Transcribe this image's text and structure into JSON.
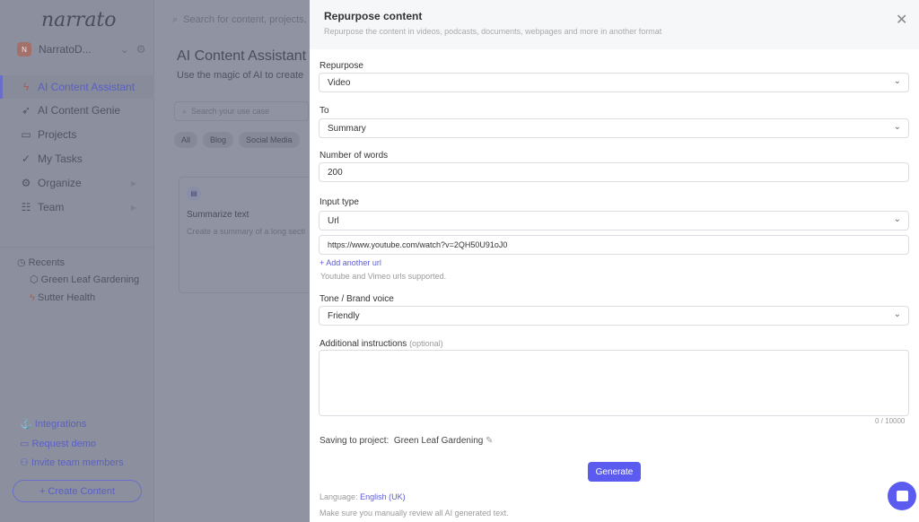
{
  "sidebar": {
    "logo": "narrato",
    "workspace": "NarratoD...",
    "workspace_initial": "N",
    "items": [
      {
        "label": "AI Content Assistant",
        "icon": "bolt-icon"
      },
      {
        "label": "AI Content Genie",
        "icon": "rocket-icon"
      },
      {
        "label": "Projects",
        "icon": "briefcase-icon"
      },
      {
        "label": "My Tasks",
        "icon": "check-icon"
      },
      {
        "label": "Organize",
        "icon": "gears-icon"
      },
      {
        "label": "Team",
        "icon": "team-icon"
      }
    ],
    "recents_label": "Recents",
    "recents": [
      "Green Leaf Gardening",
      "Sutter Health"
    ],
    "bottom": [
      "Integrations",
      "Request demo",
      "Invite team members"
    ],
    "create": "+ Create Content"
  },
  "main": {
    "search_placeholder": "Search for content, projects, a",
    "title": "AI Content Assistant",
    "subtitle": "Use the magic of AI to create",
    "usecase_placeholder": "Search your use case",
    "chips": [
      "All",
      "Blog",
      "Social Media"
    ],
    "card_title": "Summarize text",
    "card_desc": "Create a summary of a long secti"
  },
  "modal": {
    "title": "Repurpose content",
    "subtitle": "Repurpose the content in videos, podcasts, documents, webpages and more in another format",
    "repurpose_label": "Repurpose",
    "repurpose_value": "Video",
    "to_label": "To",
    "to_value": "Summary",
    "words_label": "Number of words",
    "words_value": "200",
    "input_type_label": "Input type",
    "input_type_value": "Url",
    "url_value": "https://www.youtube.com/watch?v=2QH50U91oJ0",
    "add_url": "Add another url",
    "url_help": "Youtube and Vimeo urls supported.",
    "tone_label": "Tone / Brand voice",
    "tone_value": "Friendly",
    "additional_label": "Additional instructions",
    "optional": "(optional)",
    "counter": "0 / 10000",
    "saving_label": "Saving to project:",
    "project": "Green Leaf Gardening",
    "generate": "Generate",
    "language_label": "Language:",
    "language": "English (UK)",
    "disclaimer": "Make sure you manually review all AI generated text."
  },
  "colors": {
    "accent": "#5b5bf0"
  }
}
